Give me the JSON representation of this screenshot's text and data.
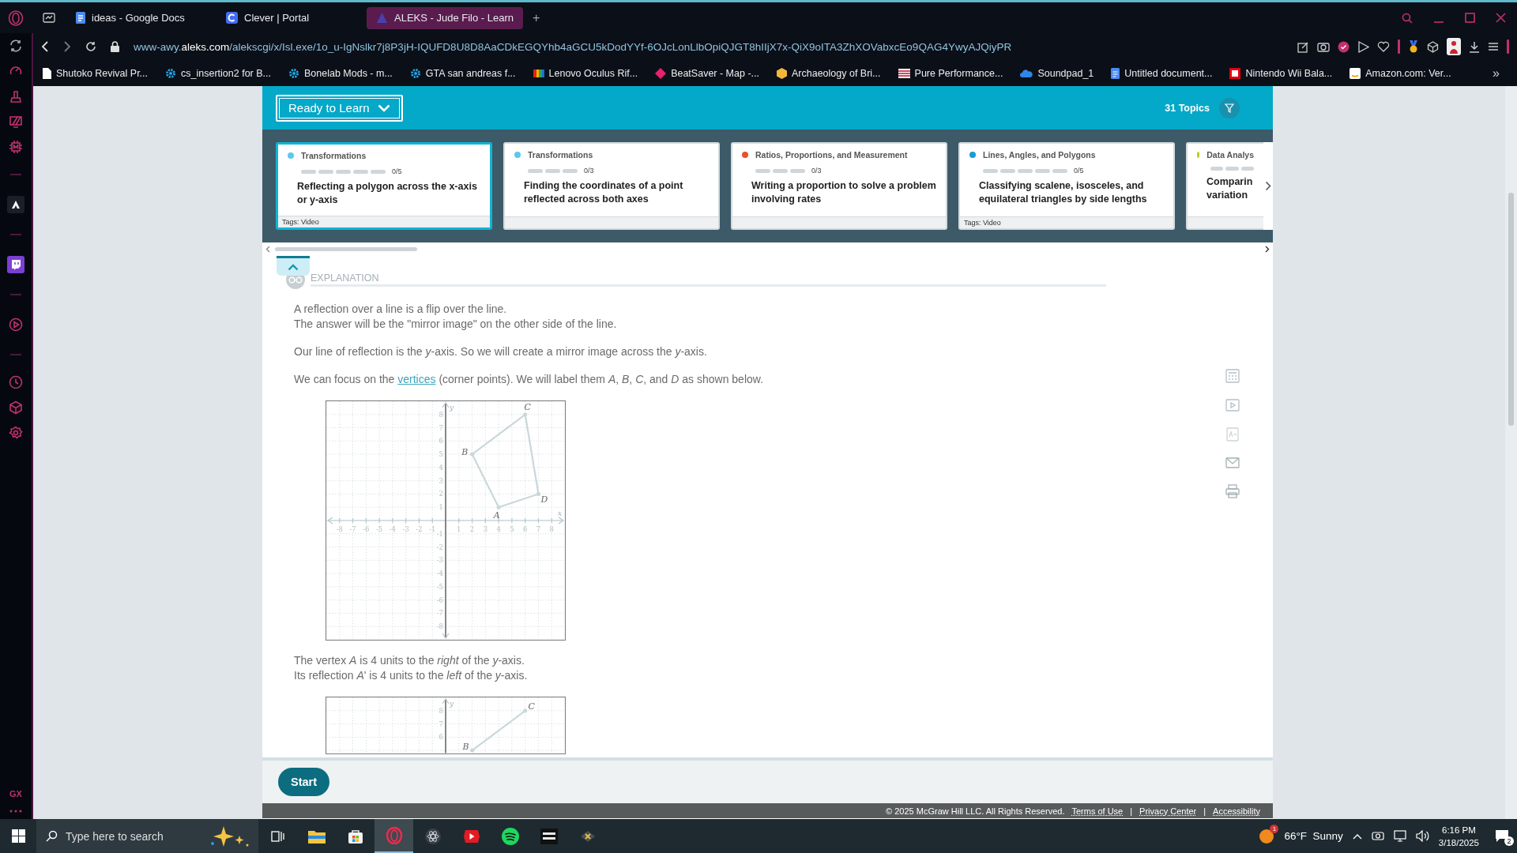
{
  "browser": {
    "tabs": [
      {
        "title": "ideas - Google Docs",
        "kind": "docs",
        "selected": false
      },
      {
        "title": "Clever | Portal",
        "kind": "clever",
        "selected": false
      },
      {
        "title": "ALEKS - Jude Filo - Learn",
        "kind": "aleks",
        "selected": true
      }
    ],
    "new_tab": "+",
    "url": "www-awy.**aleks.com**/alekscgi/x/Isl.exe/1o_u-IgNslkr7j8P3jH-IQUFD8U8D8AaCDkEGQYhb4aGCU5kDodYYf-6OJcLonLlbOpiQJGT8hIIjX7x-QiX9oITA3ZhXOVabxcEo9QAG4YwyAJQiyPR",
    "bookmarks": [
      {
        "label": "Shutoko Revival Pr...",
        "kind": "page"
      },
      {
        "label": "cs_insertion2 for B...",
        "kind": "cog"
      },
      {
        "label": "Bonelab Mods - m...",
        "kind": "cog"
      },
      {
        "label": "GTA san andreas f...",
        "kind": "cog"
      },
      {
        "label": "Lenovo Oculus Rif...",
        "kind": "stripes"
      },
      {
        "label": "BeatSaver - Map -...",
        "kind": "diamond"
      },
      {
        "label": "Archaeology of Bri...",
        "kind": "hexagon"
      },
      {
        "label": "Pure Performance...",
        "kind": "flag"
      },
      {
        "label": "Soundpad_1",
        "kind": "cloud"
      },
      {
        "label": "Untitled document...",
        "kind": "docs"
      },
      {
        "label": "Nintendo Wii Bala...",
        "kind": "square"
      },
      {
        "label": "Amazon.com: Ver...",
        "kind": "white"
      }
    ],
    "more_bookmarks": "»"
  },
  "sidebar": {
    "footer_label": "GX"
  },
  "aleks": {
    "dropdown": "Ready to Learn",
    "topic_count": "31 Topics",
    "topics": [
      {
        "category": "Transformations",
        "color": "#5cc9e8",
        "segments": [
          {
            "filled": false
          },
          {
            "filled": false
          },
          {
            "filled": false
          },
          {
            "filled": false
          },
          {
            "filled": false
          }
        ],
        "progress": "0/5",
        "title": "Reflecting a polygon across the x-axis or y-axis",
        "tags": "Tags: Video",
        "selected": true
      },
      {
        "category": "Transformations",
        "color": "#5cc9e8",
        "segments": [
          {
            "filled": false
          },
          {
            "filled": false
          },
          {
            "filled": false
          }
        ],
        "progress": "0/3",
        "title": "Finding the coordinates of a point reflected across both axes",
        "selected": false
      },
      {
        "category": "Ratios, Proportions, and Measurement",
        "color": "#e9502d",
        "segments": [
          {
            "filled": false
          },
          {
            "filled": false
          },
          {
            "filled": false
          }
        ],
        "progress": "0/3",
        "title": "Writing a proportion to solve a problem involving rates",
        "selected": false
      },
      {
        "category": "Lines, Angles, and Polygons",
        "color": "#1a9bd7",
        "segments": [
          {
            "filled": false
          },
          {
            "filled": false
          },
          {
            "filled": false
          },
          {
            "filled": false
          },
          {
            "filled": false
          }
        ],
        "progress": "0/5",
        "title": "Classifying scalene, isosceles, and equilateral triangles by side lengths",
        "tags": "Tags: Video",
        "selected": false
      },
      {
        "category": "Data Analys",
        "color": "#b6cc1a",
        "segments": [
          {
            "filled": false
          },
          {
            "filled": false
          },
          {
            "filled": false
          }
        ],
        "title": "Comparin\nvariation",
        "selected": false
      }
    ],
    "explanation": {
      "heading": "EXPLANATION",
      "blocks": [
        {
          "kind": "paragraph",
          "lines": [
            "A reflection over a line is a flip over the line.",
            "The answer will be the \"mirror image\" on the other side of the line."
          ]
        },
        {
          "kind": "paragraph",
          "lines": [
            "Our line of reflection is the *y*-axis. So we will create a mirror image across the *y*-axis."
          ]
        },
        {
          "kind": "link_paragraph",
          "before": "We can focus on the",
          "link": "vertices",
          "after": "(corner points). We will label them *A*, *B*, *C*, and *D* as shown below."
        },
        {
          "kind": "figure",
          "chart_data": {
            "type": "line",
            "grid": true,
            "xlabel": "x",
            "ylabel": "y",
            "x": [
              4,
              2,
              6,
              7
            ],
            "values": [
              1,
              5,
              8,
              2
            ],
            "xlim": [
              -9,
              9
            ],
            "ylim": [
              -9,
              9
            ],
            "xticks": [
              -8,
              -7,
              -6,
              -5,
              -4,
              -3,
              -2,
              -1,
              1,
              2,
              3,
              4,
              5,
              6,
              7,
              8
            ],
            "yticks": [
              -8,
              -7,
              -6,
              -5,
              -4,
              -3,
              -2,
              -1,
              1,
              2,
              3,
              4,
              5,
              6,
              7,
              8
            ],
            "annotations": [
              {
                "x": 4,
                "y": 1,
                "text": "A"
              },
              {
                "x": 2,
                "y": 5,
                "text": "B"
              },
              {
                "x": 6,
                "y": 8,
                "text": "C"
              },
              {
                "x": 7,
                "y": 2,
                "text": "D"
              }
            ]
          }
        },
        {
          "kind": "paragraph",
          "lines": [
            "The vertex *A* is 4 units to the *right* of the *y*-axis.",
            "Its reflection *A*' is 4 units to the *left* of the *y*-axis."
          ]
        },
        {
          "kind": "figure",
          "chart_data": {
            "type": "line",
            "grid": true,
            "ylabel": "y",
            "x": [
              2,
              6
            ],
            "values": [
              5,
              8
            ],
            "xlim": [
              -9,
              9
            ],
            "ylim": [
              4.8,
              9
            ],
            "yticks": [
              6,
              7,
              8
            ],
            "annotations": [
              {
                "x": 2,
                "y": 5,
                "text": "B"
              },
              {
                "x": 6,
                "y": 8,
                "text": "C"
              }
            ]
          }
        }
      ]
    },
    "start_button": "Start",
    "copyright": "© 2025 McGraw Hill LLC. All Rights Reserved.",
    "footer_links": [
      "Terms of Use",
      "Privacy Center",
      "Accessibility"
    ],
    "link_separator": "|"
  },
  "taskbar": {
    "search_placeholder": "Type here to search",
    "apps": [
      {
        "kind": "taskview",
        "selected": false
      },
      {
        "kind": "folder",
        "selected": false
      },
      {
        "kind": "store",
        "selected": false
      },
      {
        "kind": "ring",
        "selected": true
      },
      {
        "kind": "atom",
        "selected": false
      },
      {
        "kind": "play",
        "selected": false
      },
      {
        "kind": "spotify",
        "selected": false
      },
      {
        "kind": "blackapp",
        "selected": false
      },
      {
        "kind": "gamepad",
        "selected": false
      }
    ],
    "weather_badge": "1",
    "weather": "66°F  Sunny",
    "time": "6:16 PM",
    "date": "3/18/2025",
    "notifications": "2"
  }
}
